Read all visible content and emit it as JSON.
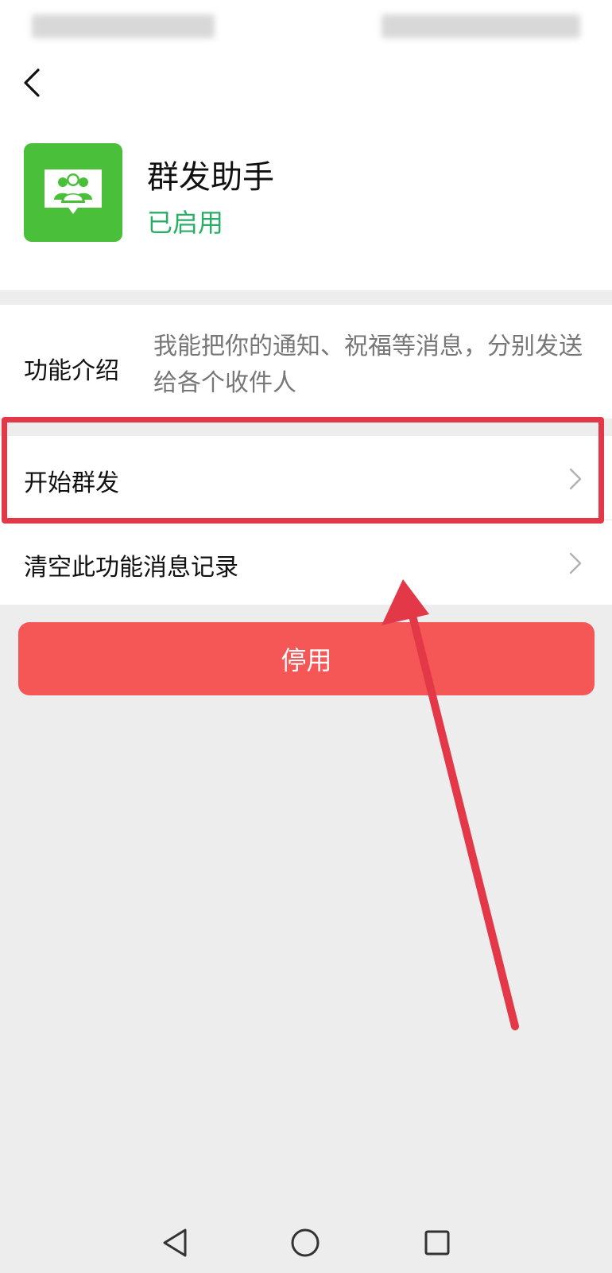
{
  "app": {
    "name": "群发助手",
    "status": "已启用"
  },
  "intro": {
    "label": "功能介绍",
    "text": "我能把你的通知、祝福等消息，分别发送给各个收件人"
  },
  "rows": [
    {
      "label": "开始群发"
    },
    {
      "label": "清空此功能消息记录"
    }
  ],
  "disable_button": {
    "label": "停用"
  },
  "icons": {
    "back": "chevron-left-icon",
    "app": "group-chat-icon",
    "nav_back": "triangle-back-icon",
    "nav_home": "circle-home-icon",
    "nav_recent": "square-recent-icon"
  },
  "colors": {
    "app_icon_bg": "#4ac03a",
    "status_green": "#2aae67",
    "disable_red": "#f55656",
    "annotation_red": "#e23847"
  }
}
